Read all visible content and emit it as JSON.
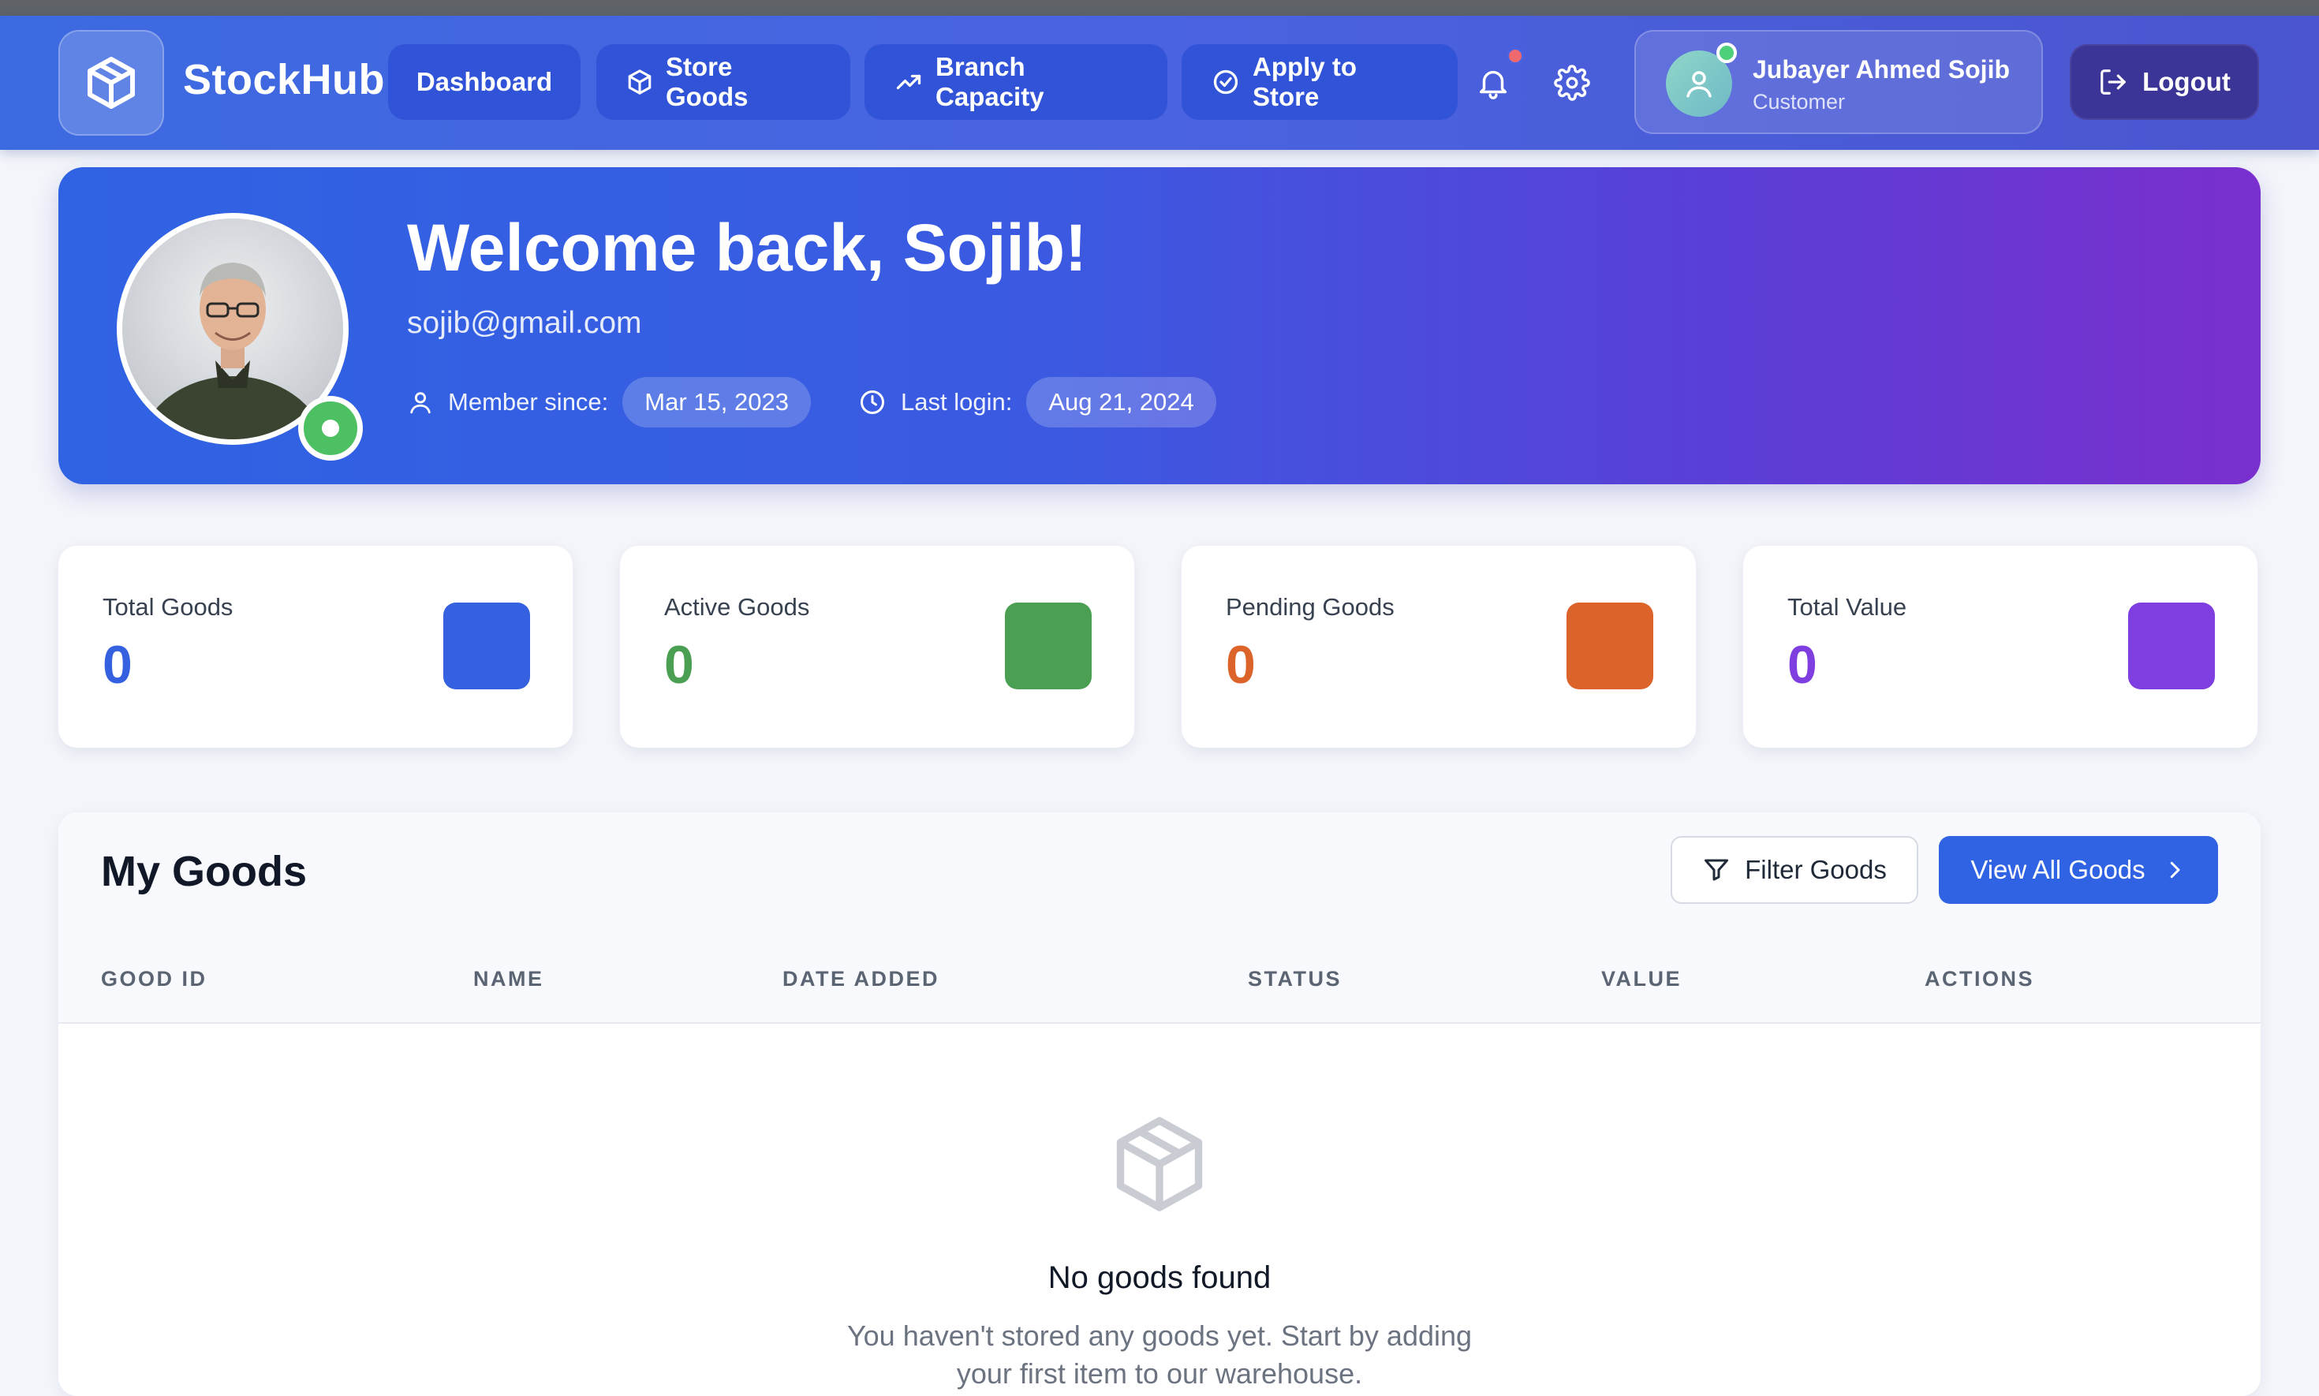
{
  "app": {
    "brand": "StockHub",
    "accent_color": "#2f63e3"
  },
  "nav": {
    "items": [
      {
        "label": "Dashboard",
        "icon": "none"
      },
      {
        "label": "Store Goods",
        "icon": "box-icon"
      },
      {
        "label": "Branch Capacity",
        "icon": "trending-up-icon"
      },
      {
        "label": "Apply to Store",
        "icon": "check-circle-icon"
      }
    ],
    "notifications_icon": "bell-icon",
    "settings_icon": "gear-icon"
  },
  "user": {
    "name": "Jubayer Ahmed Sojib",
    "role": "Customer",
    "status": "online"
  },
  "logout": {
    "label": "Logout"
  },
  "hero": {
    "greeting": "Welcome back, Sojib!",
    "email": "sojib@gmail.com",
    "member_since_label": "Member since:",
    "member_since_value": "Mar 15, 2023",
    "last_login_label": "Last login:",
    "last_login_value": "Aug 21, 2024"
  },
  "stats": [
    {
      "label": "Total Goods",
      "value": "0",
      "color": "#3561e0"
    },
    {
      "label": "Active Goods",
      "value": "0",
      "color": "#4a9f52"
    },
    {
      "label": "Pending Goods",
      "value": "0",
      "color": "#dc632a"
    },
    {
      "label": "Total Value",
      "value": "0",
      "color": "#7f3ee0"
    }
  ],
  "goods": {
    "title": "My Goods",
    "filter_label": "Filter Goods",
    "view_all_label": "View All Goods",
    "columns": [
      "GOOD ID",
      "NAME",
      "DATE ADDED",
      "STATUS",
      "VALUE",
      "ACTIONS"
    ],
    "empty_title": "No goods found",
    "empty_text": "You haven't stored any goods yet. Start by adding your first item to our warehouse."
  }
}
